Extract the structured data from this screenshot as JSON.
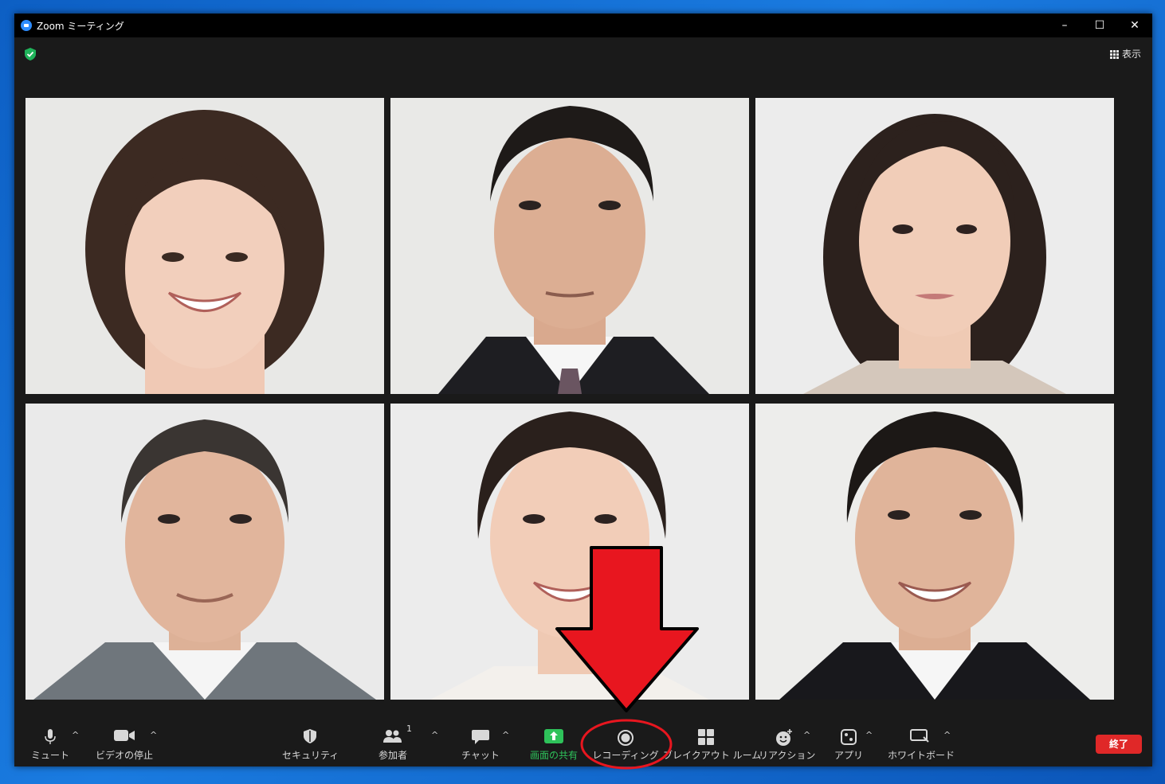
{
  "window": {
    "title": "Zoom ミーティング",
    "controls": [
      "–",
      "☐",
      "✕"
    ]
  },
  "header": {
    "view_label": "表示",
    "security_status": "shield-check-icon"
  },
  "participants": [
    {
      "id": "p1",
      "role": "participant-video"
    },
    {
      "id": "p2",
      "role": "participant-video"
    },
    {
      "id": "p3",
      "role": "participant-video"
    },
    {
      "id": "p4",
      "role": "participant-video"
    },
    {
      "id": "p5",
      "role": "participant-video"
    },
    {
      "id": "p6",
      "role": "participant-video"
    }
  ],
  "toolbar": {
    "mute": "ミュート",
    "stop_video": "ビデオの停止",
    "security": "セキュリティ",
    "participants": "参加者",
    "participants_count": "1",
    "chat": "チャット",
    "share_screen": "画面の共有",
    "recording": "レコーディング",
    "breakout": "ブレイクアウト ルーム",
    "reactions": "リアクション",
    "apps": "アプリ",
    "whiteboard": "ホワイトボード",
    "end": "終了",
    "caret": "^"
  },
  "colors": {
    "share_green": "#2ec25a",
    "end_red": "#e02828",
    "annotation_red": "#e8161f",
    "background_blue": "#1a7be0"
  }
}
